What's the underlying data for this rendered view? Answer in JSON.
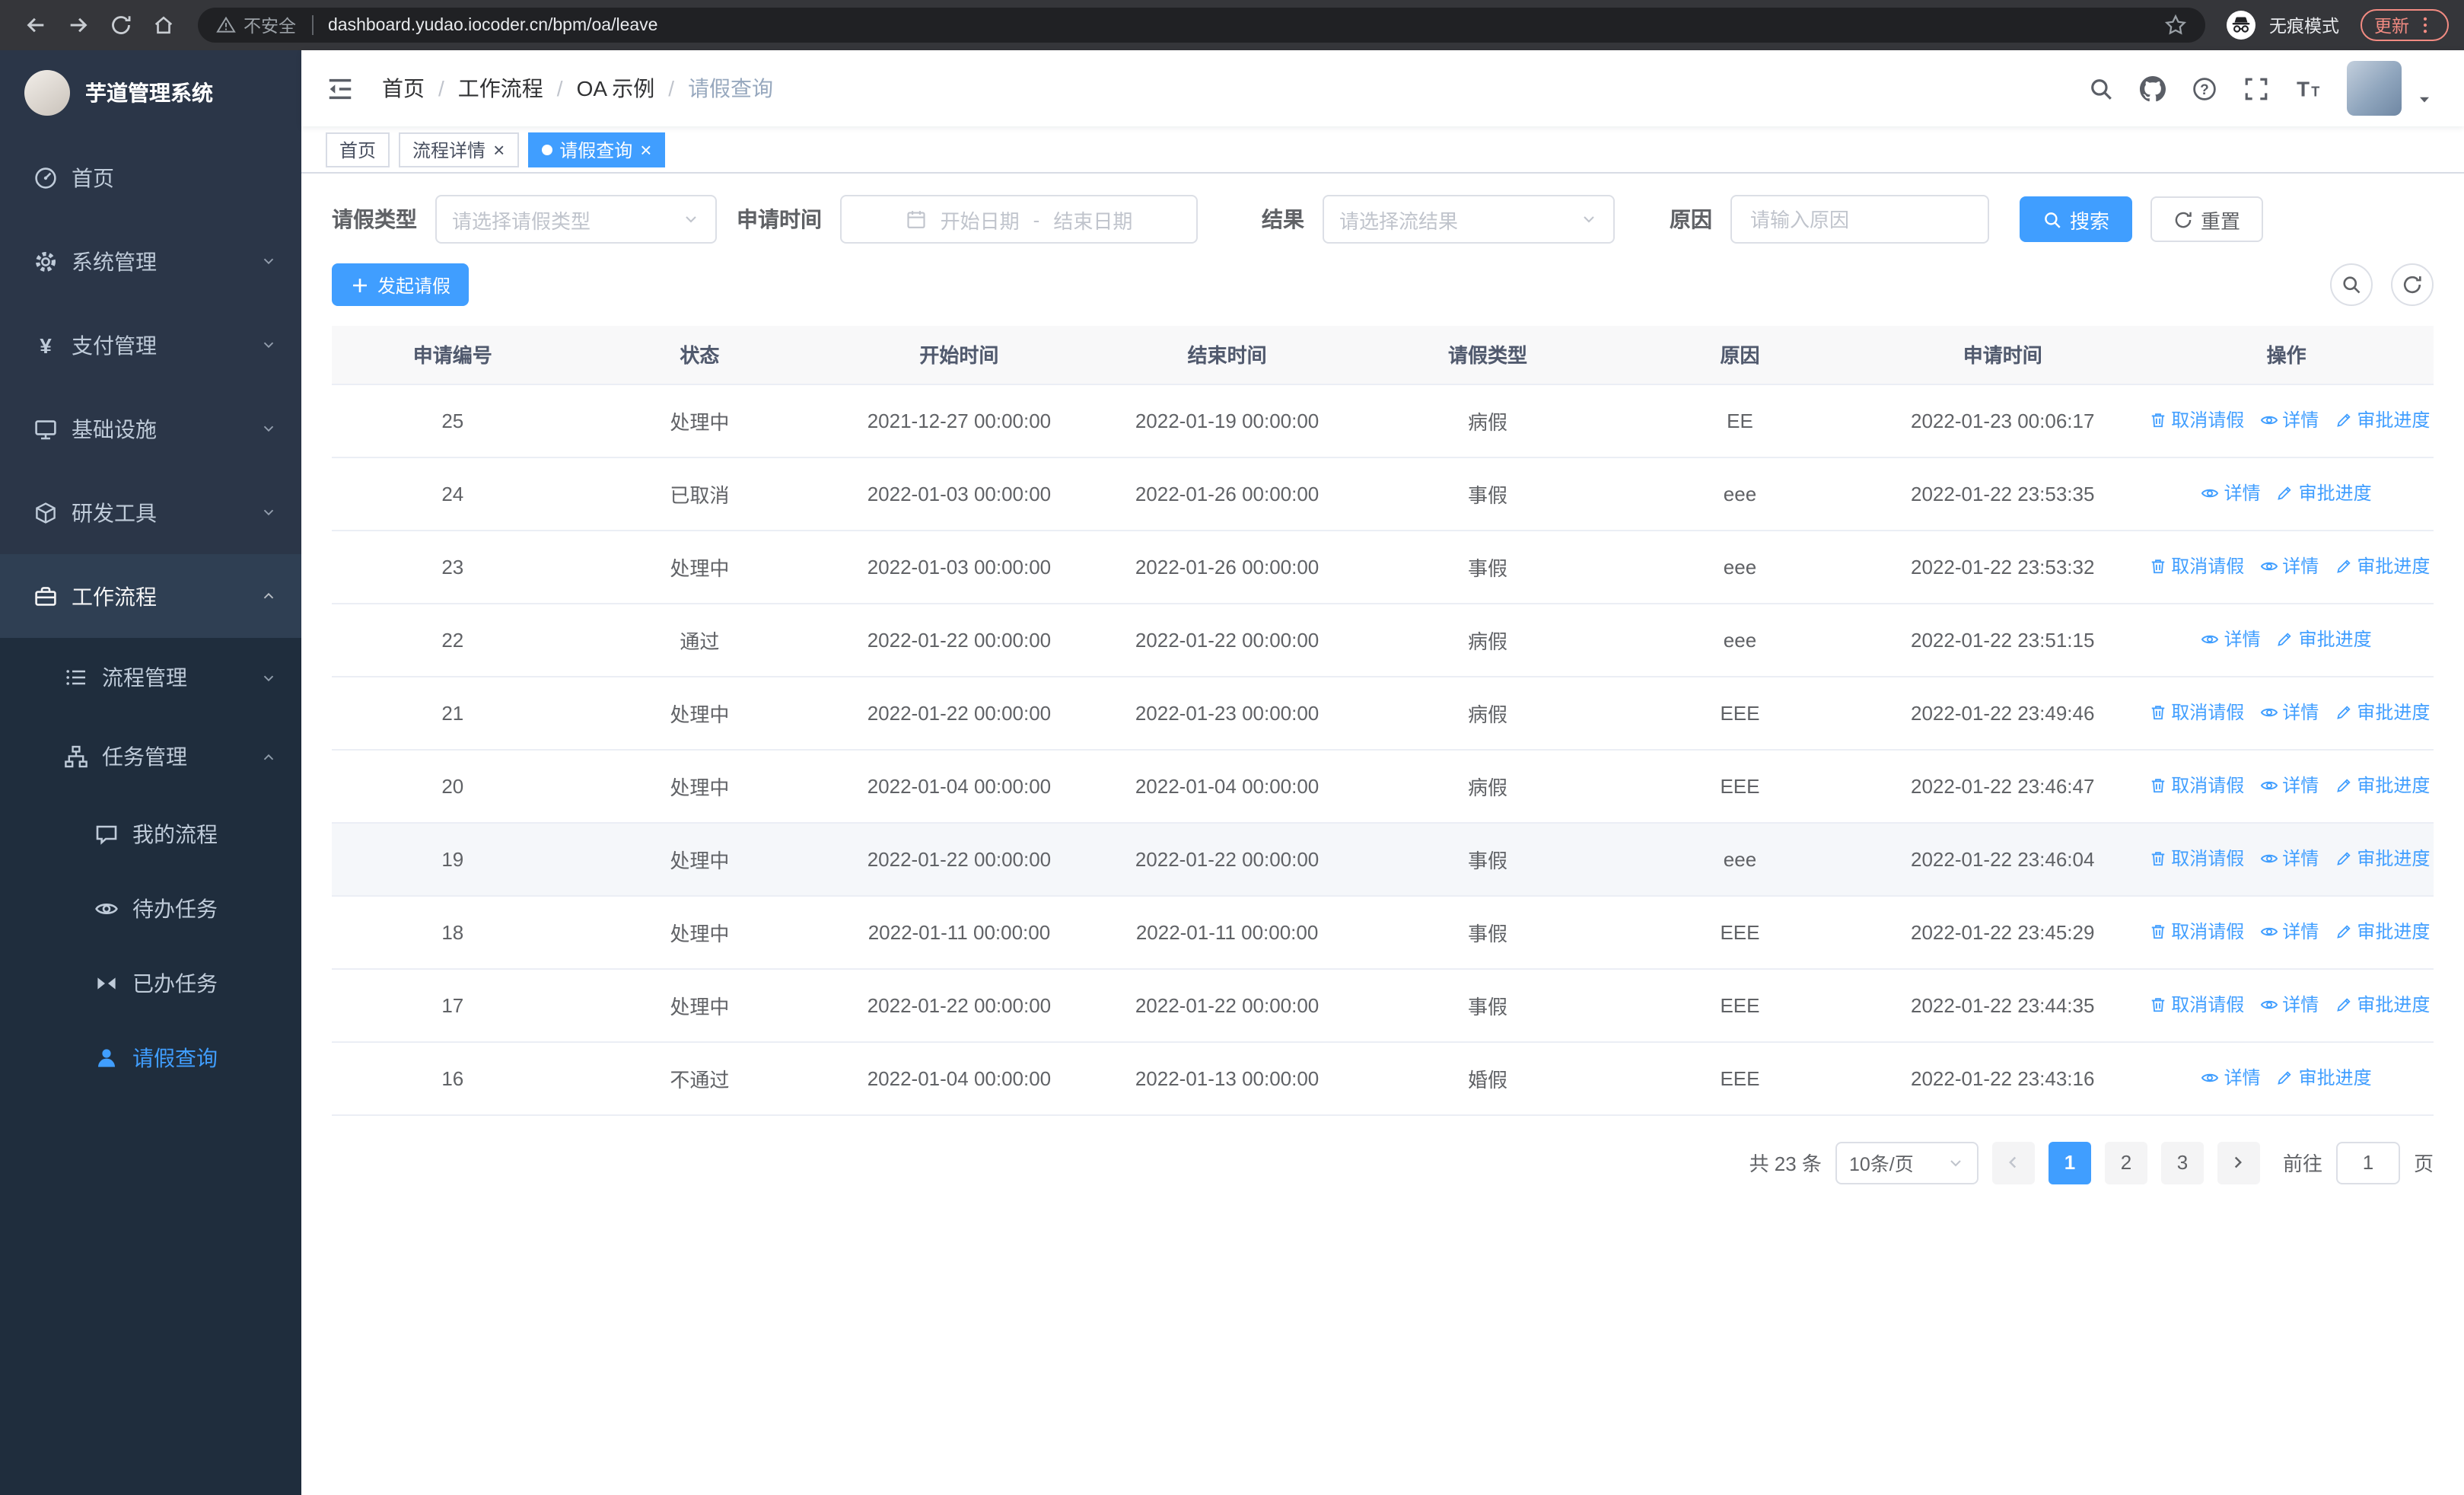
{
  "browser": {
    "security_label": "不安全",
    "url": "dashboard.yudao.iocoder.cn/bpm/oa/leave",
    "incognito_label": "无痕模式",
    "update_label": "更新"
  },
  "sidebar": {
    "title": "芋道管理系统",
    "items": [
      {
        "label": "首页",
        "icon": "dashboard-icon",
        "level": 1
      },
      {
        "label": "系统管理",
        "icon": "gear-icon",
        "level": 1,
        "chevron": "down"
      },
      {
        "label": "支付管理",
        "icon": "yen-icon",
        "level": 1,
        "chevron": "down"
      },
      {
        "label": "基础设施",
        "icon": "infrastructure-icon",
        "level": 1,
        "chevron": "down"
      },
      {
        "label": "研发工具",
        "icon": "devtools-icon",
        "level": 1,
        "chevron": "down"
      },
      {
        "label": "工作流程",
        "icon": "workflow-icon",
        "level": 1,
        "chevron": "up",
        "expanded": true
      },
      {
        "label": "流程管理",
        "icon": "process-icon",
        "level": 2,
        "chevron": "down"
      },
      {
        "label": "任务管理",
        "icon": "task-icon",
        "level": 2,
        "chevron": "up",
        "expanded": true
      },
      {
        "label": "我的流程",
        "icon": "chat-icon",
        "level": 3
      },
      {
        "label": "待办任务",
        "icon": "eye-icon",
        "level": 3
      },
      {
        "label": "已办任务",
        "icon": "done-icon",
        "level": 3
      },
      {
        "label": "请假查询",
        "icon": "user-icon",
        "level": 3,
        "active": true
      }
    ]
  },
  "header": {
    "breadcrumb": [
      "首页",
      "工作流程",
      "OA 示例",
      "请假查询"
    ]
  },
  "tabs": [
    {
      "label": "首页"
    },
    {
      "label": "流程详情",
      "closable": true
    },
    {
      "label": "请假查询",
      "closable": true,
      "active": true
    }
  ],
  "filters": {
    "type_label": "请假类型",
    "type_placeholder": "请选择请假类型",
    "time_label": "申请时间",
    "start_placeholder": "开始日期",
    "range_separator": "-",
    "end_placeholder": "结束日期",
    "result_label": "结果",
    "result_placeholder": "请选择流结果",
    "reason_label": "原因",
    "reason_placeholder": "请输入原因",
    "search_label": "搜索",
    "reset_label": "重置"
  },
  "toolbar": {
    "create_label": "发起请假"
  },
  "table": {
    "columns": [
      "申请编号",
      "状态",
      "开始时间",
      "结束时间",
      "请假类型",
      "原因",
      "申请时间",
      "操作"
    ],
    "action_icons": {
      "取消请假": "cancel-icon",
      "详情": "detail-icon",
      "审批进度": "progress-icon"
    },
    "rows": [
      {
        "id": "25",
        "status": "处理中",
        "start": "2021-12-27 00:00:00",
        "end": "2022-01-19 00:00:00",
        "type": "病假",
        "reason": "EE",
        "apply_time": "2022-01-23 00:06:17",
        "actions": [
          "取消请假",
          "详情",
          "审批进度"
        ]
      },
      {
        "id": "24",
        "status": "已取消",
        "start": "2022-01-03 00:00:00",
        "end": "2022-01-26 00:00:00",
        "type": "事假",
        "reason": "eee",
        "apply_time": "2022-01-22 23:53:35",
        "actions": [
          "详情",
          "审批进度"
        ]
      },
      {
        "id": "23",
        "status": "处理中",
        "start": "2022-01-03 00:00:00",
        "end": "2022-01-26 00:00:00",
        "type": "事假",
        "reason": "eee",
        "apply_time": "2022-01-22 23:53:32",
        "actions": [
          "取消请假",
          "详情",
          "审批进度"
        ]
      },
      {
        "id": "22",
        "status": "通过",
        "start": "2022-01-22 00:00:00",
        "end": "2022-01-22 00:00:00",
        "type": "病假",
        "reason": "eee",
        "apply_time": "2022-01-22 23:51:15",
        "actions": [
          "详情",
          "审批进度"
        ]
      },
      {
        "id": "21",
        "status": "处理中",
        "start": "2022-01-22 00:00:00",
        "end": "2022-01-23 00:00:00",
        "type": "病假",
        "reason": "EEE",
        "apply_time": "2022-01-22 23:49:46",
        "actions": [
          "取消请假",
          "详情",
          "审批进度"
        ]
      },
      {
        "id": "20",
        "status": "处理中",
        "start": "2022-01-04 00:00:00",
        "end": "2022-01-04 00:00:00",
        "type": "病假",
        "reason": "EEE",
        "apply_time": "2022-01-22 23:46:47",
        "actions": [
          "取消请假",
          "详情",
          "审批进度"
        ]
      },
      {
        "id": "19",
        "status": "处理中",
        "start": "2022-01-22 00:00:00",
        "end": "2022-01-22 00:00:00",
        "type": "事假",
        "reason": "eee",
        "apply_time": "2022-01-22 23:46:04",
        "actions": [
          "取消请假",
          "详情",
          "审批进度"
        ],
        "highlight": true
      },
      {
        "id": "18",
        "status": "处理中",
        "start": "2022-01-11 00:00:00",
        "end": "2022-01-11 00:00:00",
        "type": "事假",
        "reason": "EEE",
        "apply_time": "2022-01-22 23:45:29",
        "actions": [
          "取消请假",
          "详情",
          "审批进度"
        ]
      },
      {
        "id": "17",
        "status": "处理中",
        "start": "2022-01-22 00:00:00",
        "end": "2022-01-22 00:00:00",
        "type": "事假",
        "reason": "EEE",
        "apply_time": "2022-01-22 23:44:35",
        "actions": [
          "取消请假",
          "详情",
          "审批进度"
        ]
      },
      {
        "id": "16",
        "status": "不通过",
        "start": "2022-01-04 00:00:00",
        "end": "2022-01-13 00:00:00",
        "type": "婚假",
        "reason": "EEE",
        "apply_time": "2022-01-22 23:43:16",
        "actions": [
          "详情",
          "审批进度"
        ]
      }
    ]
  },
  "pagination": {
    "total_label": "共 23 条",
    "page_size_label": "10条/页",
    "pages": [
      "1",
      "2",
      "3"
    ],
    "active_page": "1",
    "goto_label": "前往",
    "goto_value": "1",
    "page_unit_label": "页"
  },
  "colors": {
    "accent": "#409eff",
    "sidebar_bg": "#2b3648",
    "submenu_bg": "#1f2d3d"
  }
}
